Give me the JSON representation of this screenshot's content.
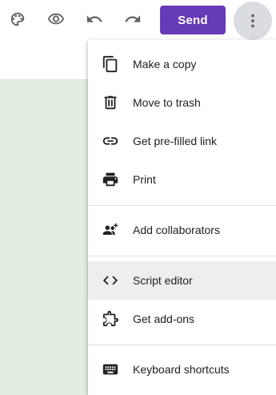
{
  "toolbar": {
    "icons": [
      "palette-icon",
      "eye-icon",
      "undo-icon",
      "redo-icon",
      "more-vert-icon"
    ],
    "send_label": "Send",
    "accent_color": "#673ab7"
  },
  "menu": {
    "items": [
      {
        "label": "Make a copy",
        "icon": "copy-icon"
      },
      {
        "label": "Move to trash",
        "icon": "trash-icon"
      },
      {
        "label": "Get pre-filled link",
        "icon": "link-icon"
      },
      {
        "label": "Print",
        "icon": "printer-icon"
      },
      {
        "label": "Add collaborators",
        "icon": "add-person-icon"
      },
      {
        "label": "Script editor",
        "icon": "code-icon"
      },
      {
        "label": "Get add-ons",
        "icon": "puzzle-icon"
      },
      {
        "label": "Keyboard shortcuts",
        "icon": "keyboard-icon"
      }
    ],
    "hovered_item": "Script editor"
  },
  "canvas": {
    "background_color": "#e3eee0"
  }
}
